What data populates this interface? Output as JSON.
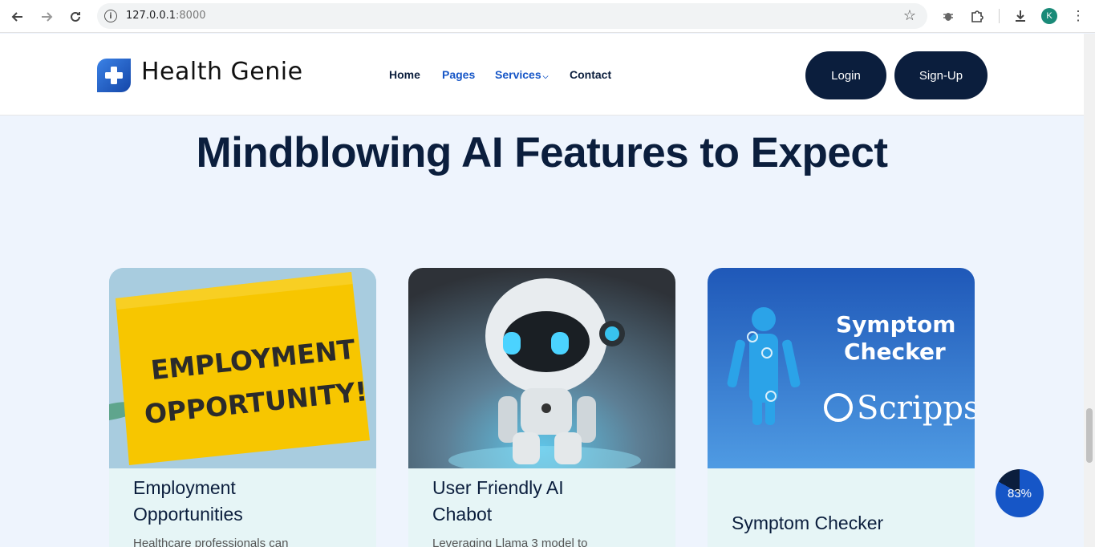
{
  "browser": {
    "url_host": "127.0.0.1",
    "url_port": ":8000",
    "profile_initial": "K"
  },
  "header": {
    "brand": "Health Genie",
    "nav": [
      {
        "label": "Home",
        "color": "#0b1e3d"
      },
      {
        "label": "Pages",
        "color": "#1656c7"
      },
      {
        "label": "Services",
        "color": "#1656c7"
      },
      {
        "label": "Contact",
        "color": "#0b1e3d"
      }
    ],
    "login_label": "Login",
    "signup_label": "Sign-Up"
  },
  "main": {
    "title": "Mindblowing AI Features to Expect",
    "cards": [
      {
        "title_line1": "Employment",
        "title_line2": "Opportunities",
        "description": "Healthcare professionals can",
        "image_text_line1": "EMPLOYMENT",
        "image_text_line2": "OPPORTUNITY!"
      },
      {
        "title_line1": "User Friendly AI",
        "title_line2": "Chabot",
        "description": "Leveraging Llama 3 model to"
      },
      {
        "title_line1": "Symptom Checker",
        "title_line2": "",
        "description": "",
        "image_text_line1": "Symptom",
        "image_text_line2": "Checker",
        "image_brand": "Scripps"
      }
    ]
  },
  "scroll_progress": {
    "label": "83%",
    "value": 0.83
  },
  "colors": {
    "navy": "#0b1e3d",
    "accent_blue": "#1656c7",
    "page_bg": "#eef4fd",
    "card_bg": "#e6f5f6"
  }
}
